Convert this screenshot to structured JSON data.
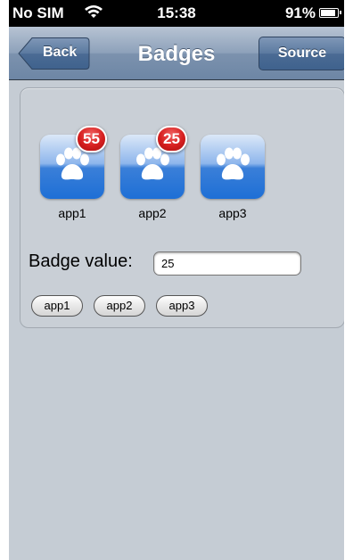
{
  "status_bar": {
    "carrier": "No SIM",
    "time": "15:38",
    "battery": "91%"
  },
  "nav": {
    "title": "Badges",
    "back_label": "Back",
    "source_label": "Source"
  },
  "apps": [
    {
      "label": "app1",
      "badge": "55"
    },
    {
      "label": "app2",
      "badge": "25"
    },
    {
      "label": "app3",
      "badge": ""
    }
  ],
  "badge_value": {
    "label": "Badge value:",
    "value": "25"
  },
  "buttons": [
    "app1",
    "app2",
    "app3"
  ],
  "colors": {
    "nav_bar": "#7c92ae",
    "background": "#c5ccd4",
    "badge": "#d61f1f",
    "icon": "#1e6fd6"
  },
  "icons": {
    "app_icon": "paw-icon",
    "wifi": "wifi-icon",
    "battery": "battery-icon"
  }
}
